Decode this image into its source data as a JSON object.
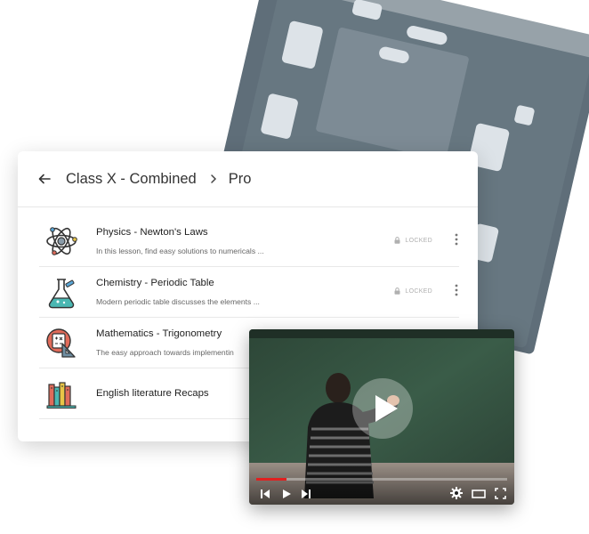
{
  "header": {
    "breadcrumb_root": "Class X - Combined",
    "breadcrumb_current": "Pro"
  },
  "lessons": [
    {
      "title": "Physics - Newton's Laws",
      "description": "In this lesson, find easy solutions to numericals ...",
      "status": "LOCKED",
      "icon": "atom-icon"
    },
    {
      "title": "Chemistry - Periodic Table",
      "description": "Modern periodic table discusses the elements ...",
      "status": "LOCKED",
      "icon": "flask-icon"
    },
    {
      "title": "Mathematics - Trigonometry",
      "description": "The  easy approach towards  implementin",
      "status": "",
      "icon": "math-tools-icon"
    },
    {
      "title": "English literature Recaps",
      "description": "",
      "status": "",
      "icon": "books-icon"
    }
  ],
  "player": {
    "progress_fraction": 0.12
  },
  "colors": {
    "tile_dark": "#5f6e79",
    "tile_light": "#dde3e8",
    "progress": "#e02020",
    "board": "#2f4d3a"
  }
}
